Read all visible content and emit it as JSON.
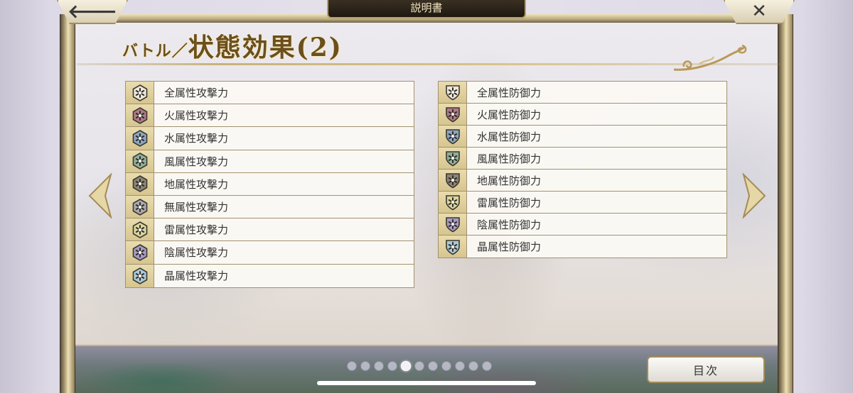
{
  "header": {
    "title": "説明書"
  },
  "nav": {
    "back_glyph": "🡐",
    "close_glyph": "✕"
  },
  "page": {
    "title_prefix": "バトル／",
    "title_main": "状態効果(2)"
  },
  "lists": {
    "attack": [
      {
        "label": "全属性攻撃力",
        "icon": "attack-up-all-icon",
        "color": "#ece7da"
      },
      {
        "label": "火属性攻撃力",
        "icon": "attack-up-fire-icon",
        "color": "#b07a88"
      },
      {
        "label": "水属性攻撃力",
        "icon": "attack-up-water-icon",
        "color": "#8aa6c2"
      },
      {
        "label": "風属性攻撃力",
        "icon": "attack-up-wind-icon",
        "color": "#8fb09a"
      },
      {
        "label": "地属性攻撃力",
        "icon": "attack-up-earth-icon",
        "color": "#8c8577"
      },
      {
        "label": "無属性攻撃力",
        "icon": "attack-up-none-icon",
        "color": "#a9a9ae"
      },
      {
        "label": "雷属性攻撃力",
        "icon": "attack-up-thunder-icon",
        "color": "#d8d79c"
      },
      {
        "label": "陰属性攻撃力",
        "icon": "attack-up-shadow-icon",
        "color": "#a59bc4"
      },
      {
        "label": "晶属性攻撃力",
        "icon": "attack-up-crystal-icon",
        "color": "#a9c9d6"
      }
    ],
    "defense": [
      {
        "label": "全属性防御力",
        "icon": "defense-up-all-icon",
        "color": "#ece7da"
      },
      {
        "label": "火属性防御力",
        "icon": "defense-up-fire-icon",
        "color": "#b07a88"
      },
      {
        "label": "水属性防御力",
        "icon": "defense-up-water-icon",
        "color": "#8aa6c2"
      },
      {
        "label": "風属性防御力",
        "icon": "defense-up-wind-icon",
        "color": "#8fb09a"
      },
      {
        "label": "地属性防御力",
        "icon": "defense-up-earth-icon",
        "color": "#8c8577"
      },
      {
        "label": "雷属性防御力",
        "icon": "defense-up-thunder-icon",
        "color": "#d8d79c"
      },
      {
        "label": "陰属性防御力",
        "icon": "defense-up-shadow-icon",
        "color": "#a59bc4"
      },
      {
        "label": "晶属性防御力",
        "icon": "defense-up-crystal-icon",
        "color": "#a9c9d6"
      }
    ]
  },
  "pager": {
    "total": 11,
    "current": 5
  },
  "footer": {
    "toc_label": "目次"
  }
}
